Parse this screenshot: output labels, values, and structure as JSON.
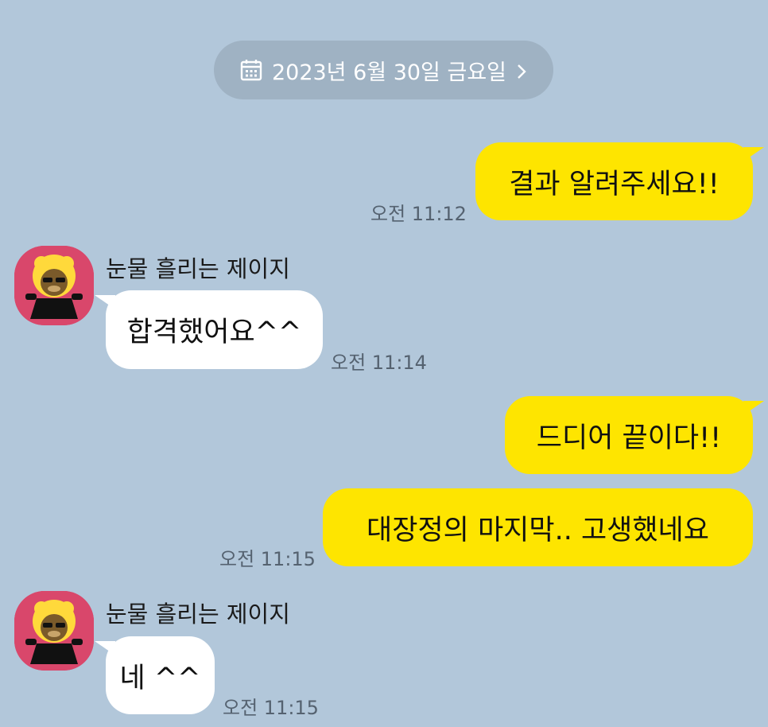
{
  "date_divider": {
    "label": "2023년 6월 30일 금요일",
    "icon": "calendar-icon",
    "chevron": "chevron-right-icon"
  },
  "messages": [
    {
      "from": "me",
      "text": "결과 알려주세요!!",
      "time": "오전 11:12"
    },
    {
      "from": "them",
      "sender": "눈물 흘리는 제이지",
      "text": "합격했어요^^",
      "time": "오전 11:14"
    },
    {
      "from": "me",
      "text": "드디어 끝이다!!",
      "time": ""
    },
    {
      "from": "me",
      "text": "대장정의 마지막.. 고생했네요",
      "time": "오전 11:15"
    },
    {
      "from": "them",
      "sender": "눈물 흘리는 제이지",
      "text": "네 ^^",
      "time": "오전 11:15"
    }
  ],
  "colors": {
    "background": "#b2c7da",
    "my_bubble": "#fee500",
    "their_bubble": "#ffffff",
    "avatar_bg": "#d9476b",
    "date_pill": "#9fb2c3"
  }
}
